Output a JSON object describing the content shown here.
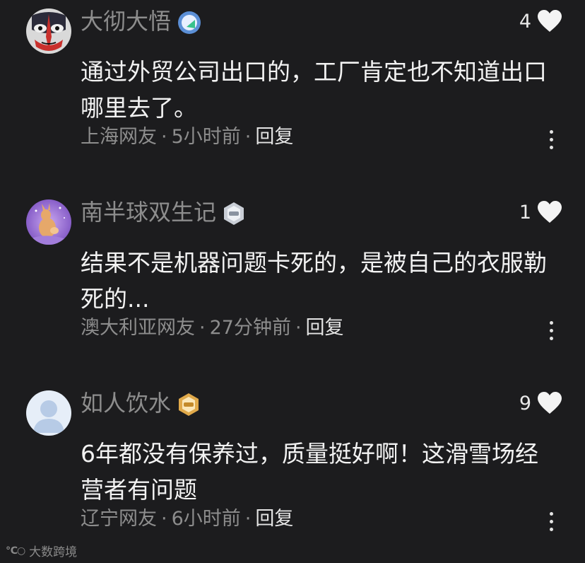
{
  "comments": [
    {
      "username": "大彻大悟",
      "badge": "level-badge-icon",
      "like_count": "4",
      "text": "通过外贸公司出口的，工厂肯定也不知道出口哪里去了。",
      "location": "上海网友",
      "time": "5小时前",
      "reply_label": "回复"
    },
    {
      "username": "南半球双生记",
      "badge": "level-badge-icon",
      "like_count": "1",
      "text": "结果不是机器问题卡死的，是被自己的衣服勒死的...",
      "location": "澳大利亚网友",
      "time": "27分钟前",
      "reply_label": "回复"
    },
    {
      "username": "如人饮水",
      "badge": "level-badge-icon",
      "like_count": "9",
      "text": "6年都没有保养过，质量挺好啊！这滑雪场经营者有问题",
      "location": "辽宁网友",
      "time": "6小时前",
      "reply_label": "回复"
    }
  ],
  "watermark": "大数跨境",
  "colors": {
    "background": "#1c1c1e",
    "text": "#f2f2f2",
    "muted": "#8d8d8d"
  }
}
